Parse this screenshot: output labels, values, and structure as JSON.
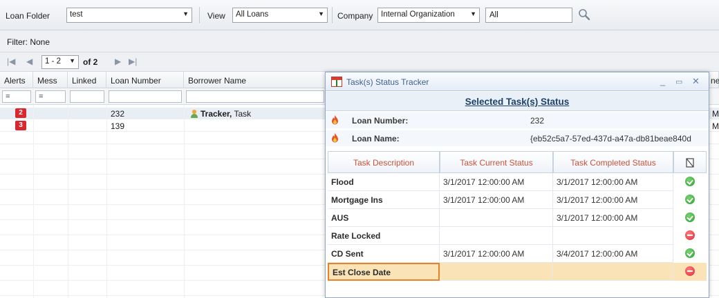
{
  "toolbar": {
    "loan_folder_label": "Loan Folder",
    "loan_folder_value": "test",
    "view_label": "View",
    "view_value": "All Loans",
    "company_label": "Company",
    "company_value": "Internal Organization",
    "search_value": "All"
  },
  "filter": {
    "text": "Filter: None"
  },
  "pager": {
    "range": "1 - 2",
    "of_text": "of 2"
  },
  "grid": {
    "columns": [
      "Alerts",
      "Mess",
      "Linked",
      "Loan Number",
      "Borrower Name"
    ],
    "filter_alerts": "=",
    "filter_mess": "=",
    "rows": [
      {
        "alerts": "2",
        "loan_number": "232",
        "borrower_last": "Tracker,",
        "borrower_first": "Task"
      },
      {
        "alerts": "3",
        "loan_number": "139",
        "borrower_last": "",
        "borrower_first": ""
      }
    ],
    "clipped_right": [
      "ne",
      "M",
      "M"
    ]
  },
  "dialog": {
    "title": "Task(s) Status Tracker",
    "heading": "Selected Task(s) Status",
    "loan_number_label": "Loan Number:",
    "loan_number_value": "232",
    "loan_name_label": "Loan Name:",
    "loan_name_value": "{eb52c5a7-57ed-437d-a47a-db81beae840d",
    "columns": [
      "Task Description",
      "Task Current Status",
      "Task Completed Status"
    ],
    "tasks": [
      {
        "desc": "Flood",
        "current": "3/1/2017 12:00:00 AM",
        "completed": "3/1/2017 12:00:00 AM",
        "status": "ok"
      },
      {
        "desc": "Mortgage Ins",
        "current": "3/1/2017 12:00:00 AM",
        "completed": "3/1/2017 12:00:00 AM",
        "status": "ok"
      },
      {
        "desc": "AUS",
        "current": "",
        "completed": "3/1/2017 12:00:00 AM",
        "status": "ok"
      },
      {
        "desc": "Rate Locked",
        "current": "",
        "completed": "",
        "status": "blocked"
      },
      {
        "desc": "CD Sent",
        "current": "3/1/2017 12:00:00 AM",
        "completed": "3/4/2017 12:00:00 AM",
        "status": "ok"
      },
      {
        "desc": "Est Close Date",
        "current": "",
        "completed": "",
        "status": "blocked"
      }
    ]
  },
  "colors": {
    "alert": "#d9272e",
    "header_text": "#c8523a",
    "title_text": "#3b5f8f",
    "ok": "#2e9e3a",
    "blocked": "#d9303a",
    "highlight": "#fbe3b8"
  }
}
